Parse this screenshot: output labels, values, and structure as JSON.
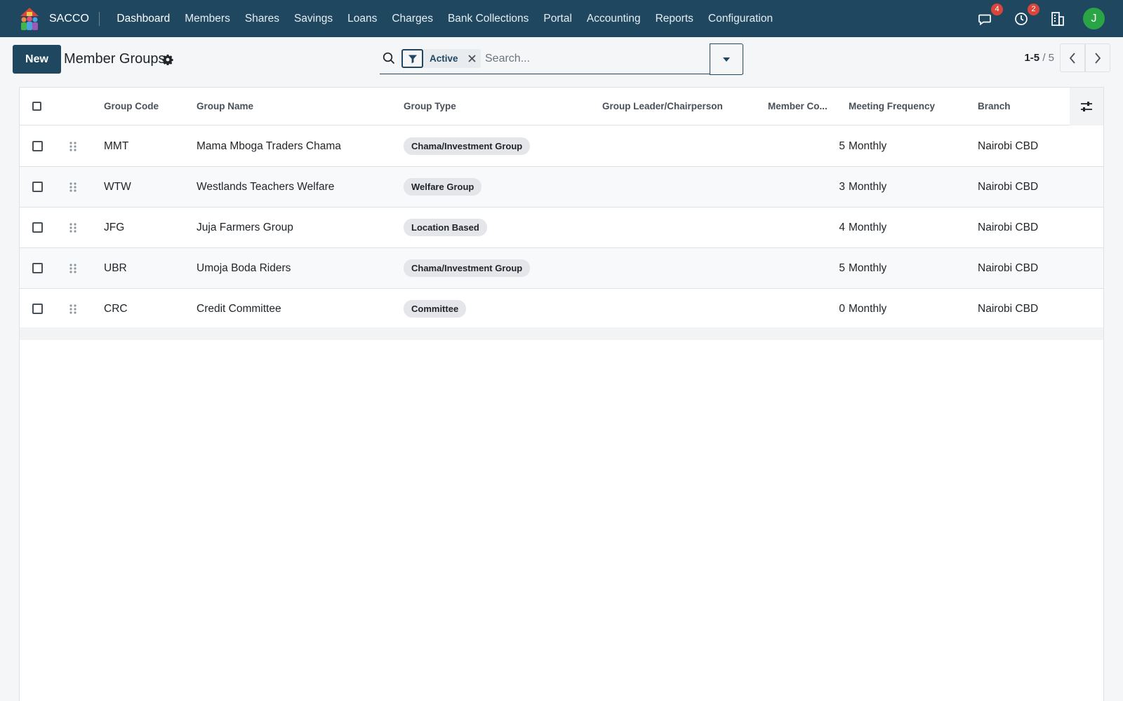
{
  "navbar": {
    "brand": "SACCO",
    "menu": [
      "Dashboard",
      "Members",
      "Shares",
      "Savings",
      "Loans",
      "Charges",
      "Bank Collections",
      "Portal",
      "Accounting",
      "Reports",
      "Configuration"
    ],
    "messages_count": "4",
    "activities_count": "2",
    "user_initial": "J",
    "accent_color": "#1f4860",
    "avatar_color": "#2aa545"
  },
  "control_panel": {
    "new_label": "New",
    "title": "Member Groups",
    "facet_label": "Active",
    "search_placeholder": "Search...",
    "pager_value": "1-5",
    "pager_limit": "5"
  },
  "table": {
    "headers": {
      "code": "Group Code",
      "name": "Group Name",
      "type": "Group Type",
      "leader": "Group Leader/Chairperson",
      "count": "Member Co...",
      "frequency": "Meeting Frequency",
      "branch": "Branch"
    },
    "rows": [
      {
        "code": "MMT",
        "name": "Mama Mboga Traders Chama",
        "type": "Chama/Investment Group",
        "leader": "",
        "count": "5",
        "frequency": "Monthly",
        "branch": "Nairobi CBD"
      },
      {
        "code": "WTW",
        "name": "Westlands Teachers Welfare",
        "type": "Welfare Group",
        "leader": "",
        "count": "3",
        "frequency": "Monthly",
        "branch": "Nairobi CBD"
      },
      {
        "code": "JFG",
        "name": "Juja Farmers Group",
        "type": "Location Based",
        "leader": "",
        "count": "4",
        "frequency": "Monthly",
        "branch": "Nairobi CBD"
      },
      {
        "code": "UBR",
        "name": "Umoja Boda Riders",
        "type": "Chama/Investment Group",
        "leader": "",
        "count": "5",
        "frequency": "Monthly",
        "branch": "Nairobi CBD"
      },
      {
        "code": "CRC",
        "name": "Credit Committee",
        "type": "Committee",
        "leader": "",
        "count": "0",
        "frequency": "Monthly",
        "branch": "Nairobi CBD"
      }
    ]
  }
}
